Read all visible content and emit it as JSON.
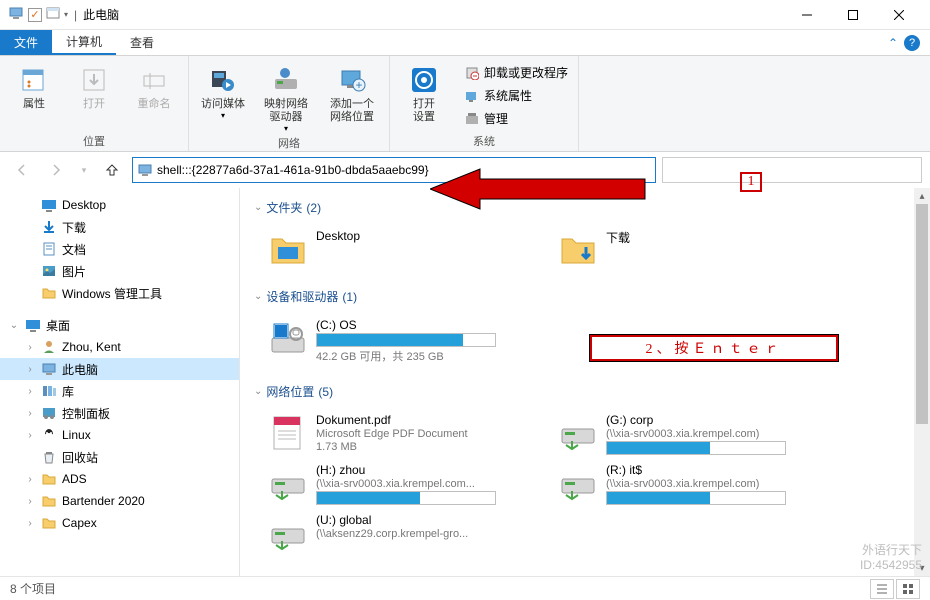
{
  "window": {
    "title": "此电脑"
  },
  "tabs": {
    "file": "文件",
    "computer": "计算机",
    "view": "查看"
  },
  "ribbon": {
    "group_location": "位置",
    "group_network": "网络",
    "group_system": "系统",
    "properties": "属性",
    "open": "打开",
    "rename": "重命名",
    "access_media": "访问媒体",
    "map_drive": "映射网络\n驱动器",
    "add_net_location": "添加一个\n网络位置",
    "open_settings": "打开\n设置",
    "uninstall": "卸载或更改程序",
    "sys_props": "系统属性",
    "manage": "管理"
  },
  "address": {
    "value": "shell:::{22877a6d-37a1-461a-91b0-dbda5aaebc99}"
  },
  "tree": {
    "desktop": "Desktop",
    "downloads": "下载",
    "documents": "文档",
    "pictures": "图片",
    "admintools": "Windows 管理工具",
    "desk_root": "桌面",
    "user": "Zhou, Kent",
    "thispc": "此电脑",
    "libraries": "库",
    "controlpanel": "控制面板",
    "linux": "Linux",
    "recycle": "回收站",
    "ads": "ADS",
    "bartender": "Bartender 2020",
    "capex": "Capex"
  },
  "sections": {
    "folders": {
      "title": "文件夹",
      "count": "(2)"
    },
    "devices": {
      "title": "设备和驱动器",
      "count": "(1)"
    },
    "network": {
      "title": "网络位置",
      "count": "(5)"
    }
  },
  "items": {
    "folder_desktop": "Desktop",
    "folder_downloads": "下载",
    "drive_c": {
      "name": "(C:) OS",
      "sub": "42.2 GB 可用，共 235 GB",
      "fill": 82
    },
    "pdf": {
      "name": "Dokument.pdf",
      "sub1": "Microsoft Edge PDF Document",
      "sub2": "1.73 MB"
    },
    "g": {
      "name": "(G:) corp",
      "sub": "(\\\\xia-srv0003.xia.krempel.com)",
      "fill": 58
    },
    "h": {
      "name": "(H:) zhou",
      "sub": "(\\\\xia-srv0003.xia.krempel.com...",
      "fill": 58
    },
    "r": {
      "name": "(R:) it$",
      "sub": "(\\\\xia-srv0003.xia.krempel.com)",
      "fill": 58
    },
    "u": {
      "name": "(U:) global",
      "sub": "(\\\\aksenz29.corp.krempel-gro..."
    }
  },
  "status": {
    "count": "8 个项目"
  },
  "annot": {
    "one": "1",
    "two": "2、按Ｅｎｔｅｒ"
  },
  "watermark": {
    "line1": "外语行天下",
    "line2": "ID:4542955"
  }
}
